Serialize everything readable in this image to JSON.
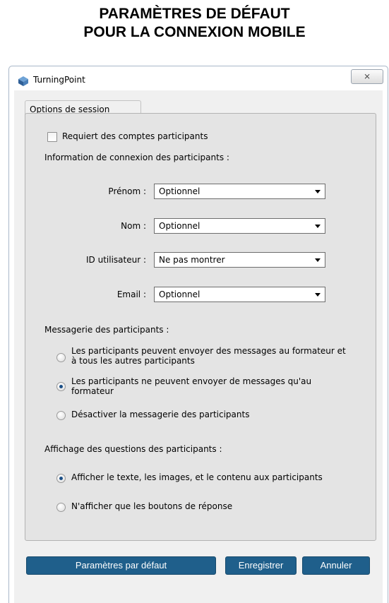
{
  "page": {
    "title_line1": "PARAMÈTRES DE DÉFAUT",
    "title_line2": "POUR LA CONNEXION MOBILE"
  },
  "window": {
    "app_title": "TurningPoint",
    "close_glyph": "⨯",
    "group_title": "Options de session"
  },
  "session": {
    "require_accounts_label": "Requiert des comptes participants",
    "require_accounts_checked": false,
    "login_info_heading": "Information de connexion des participants :",
    "fields": [
      {
        "label": "Prénom :",
        "value": "Optionnel"
      },
      {
        "label": "Nom :",
        "value": "Optionnel"
      },
      {
        "label": "ID utilisateur :",
        "value": "Ne pas montrer"
      },
      {
        "label": "Email :",
        "value": "Optionnel"
      }
    ],
    "messaging_heading": "Messagerie des participants :",
    "messaging_options": [
      {
        "line1": "Les participants peuvent envoyer des messages au formateur et",
        "line2": "à tous les autres participants",
        "checked": false
      },
      {
        "line1": "Les participants ne peuvent envoyer de messages qu'au",
        "line2": "formateur",
        "checked": true
      },
      {
        "line1": "Désactiver la messagerie des participants",
        "line2": "",
        "checked": false
      }
    ],
    "display_heading": "Affichage des questions des participants :",
    "display_options": [
      {
        "label": "Afficher le texte, les images, et le contenu aux participants",
        "checked": true
      },
      {
        "label": "N'afficher que les boutons de réponse",
        "checked": false
      }
    ]
  },
  "buttons": {
    "defaults": "Paramètres par défaut",
    "save": "Enregistrer",
    "cancel": "Annuler"
  },
  "colors": {
    "button_bg": "#1f5f8b",
    "radio_dot": "#1b4f86"
  }
}
